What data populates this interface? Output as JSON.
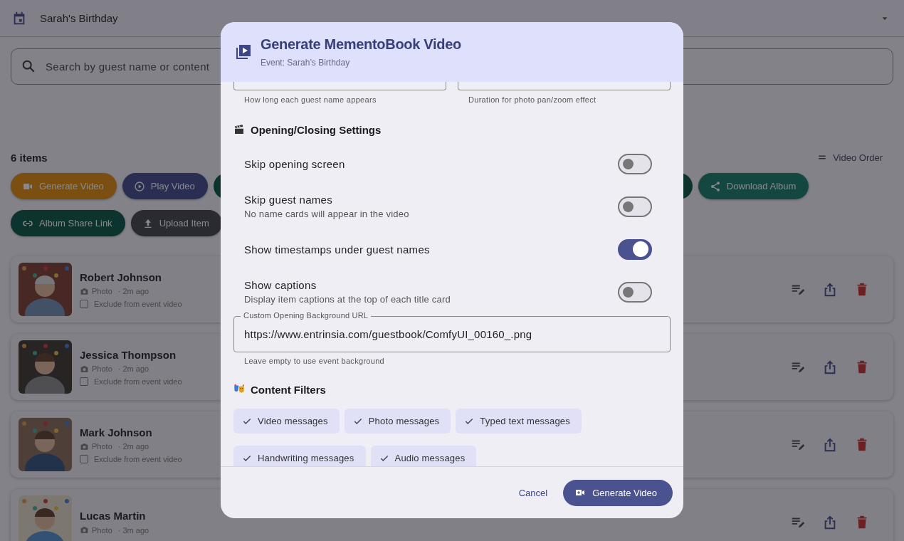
{
  "app_bar": {
    "title": "Sarah's Birthday"
  },
  "search": {
    "placeholder": "Search by guest name or content"
  },
  "item_count": "6 items",
  "video_order": "Video Order",
  "action_rows": [
    [
      {
        "label": "Generate Video",
        "kind": "video"
      },
      {
        "label": "Play Video",
        "kind": "play"
      },
      {
        "kind": "covered"
      },
      {
        "label": "Download Album",
        "kind": "share"
      }
    ],
    [
      {
        "label": "Album Share Link",
        "kind": "link"
      },
      {
        "label": "Upload Item",
        "kind": "upload"
      }
    ]
  ],
  "items": [
    {
      "name": "Robert Johnson",
      "type": "Photo",
      "time": "· 2m ago",
      "exclude": {
        "label": "Exclude from event video",
        "checked": false
      }
    },
    {
      "name": "Jessica Thompson",
      "type": "Photo",
      "time": "· 2m ago",
      "exclude": {
        "label": "Exclude from event video",
        "checked": false
      }
    },
    {
      "name": "Mark Johnson",
      "type": "Photo",
      "time": "· 2m ago",
      "exclude": {
        "label": "Exclude from event video",
        "checked": false
      }
    },
    {
      "name": "Lucas Martin",
      "type": "Photo",
      "time": "· 3m ago"
    }
  ],
  "dialog": {
    "title": "Generate MementoBook Video",
    "subtitle": "Event: Sarah’s Birthday",
    "duration_fields": [
      {
        "helper": "How long each guest name appears"
      },
      {
        "helper": "Duration for photo pan/zoom effect"
      }
    ],
    "opening_closing": {
      "heading": "Opening/Closing Settings",
      "switches": [
        {
          "label": "Skip opening screen",
          "on": false
        },
        {
          "label": "Skip guest names",
          "description": "No name cards will appear in the video",
          "on": false
        },
        {
          "label": "Show timestamps under guest names",
          "on": true
        },
        {
          "label": "Show captions",
          "description": "Display item captions at the top of each title card",
          "on": false
        }
      ]
    },
    "background_url": {
      "label": "Custom Opening Background URL",
      "value": "https://www.entrinsia.com/guestbook/ComfyUI_00160_.png",
      "helper": "Leave empty to use event background"
    },
    "content_filters": {
      "heading": "Content Filters",
      "chips": [
        {
          "label": "Video messages",
          "selected": true
        },
        {
          "label": "Photo messages",
          "selected": true
        },
        {
          "label": "Typed text messages",
          "selected": true
        },
        {
          "label": "Handwriting messages",
          "selected": true
        },
        {
          "label": "Audio messages",
          "selected": true
        }
      ]
    },
    "buttons": {
      "cancel": "Cancel",
      "confirm": "Generate Video"
    }
  }
}
